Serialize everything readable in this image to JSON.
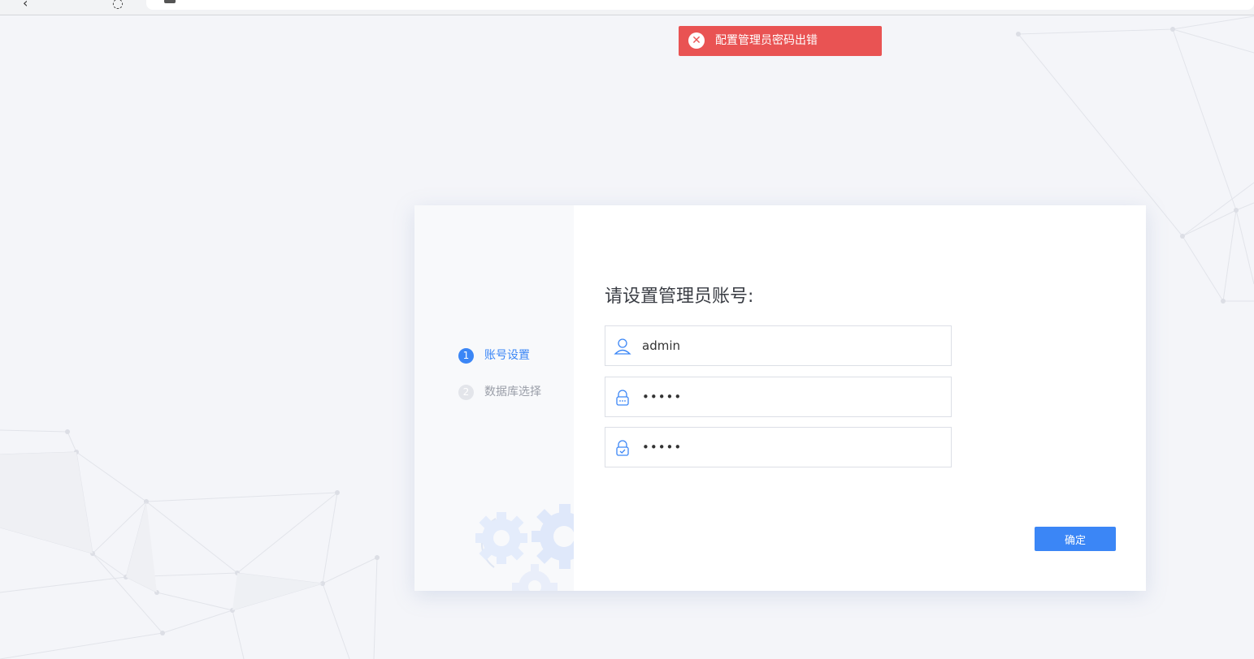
{
  "toast": {
    "type": "error",
    "icon": "close-circle-icon",
    "message": "配置管理员密码出错",
    "color": "#e95353"
  },
  "steps": [
    {
      "number": "1",
      "label": "账号设置",
      "state": "active"
    },
    {
      "number": "2",
      "label": "数据库选择",
      "state": "inactive"
    }
  ],
  "form": {
    "title": "请设置管理员账号:",
    "username": {
      "icon": "user-icon",
      "value": "admin"
    },
    "password": {
      "icon": "lock-icon",
      "value": "•••••"
    },
    "confirm_password": {
      "icon": "lock-check-icon",
      "value": "•••••"
    },
    "submit_label": "确定"
  },
  "colors": {
    "accent": "#3b86f6",
    "error": "#e95353",
    "background": "#f4f5f9"
  }
}
